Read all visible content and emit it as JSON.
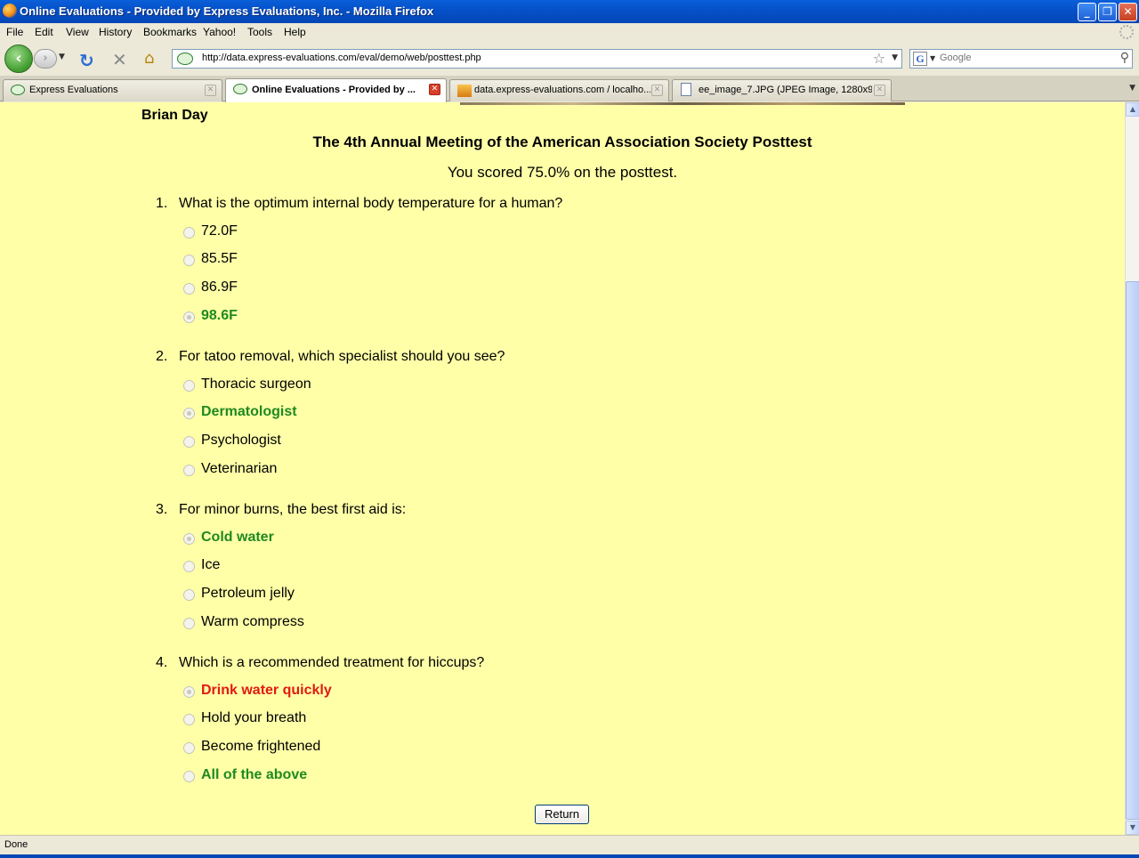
{
  "window": {
    "title": "Online Evaluations - Provided by Express Evaluations, Inc. - Mozilla Firefox",
    "minimize_label": "_",
    "restore_label": "❐",
    "close_label": "✕"
  },
  "menu": [
    "File",
    "Edit",
    "View",
    "History",
    "Bookmarks",
    "Yahoo!",
    "Tools",
    "Help"
  ],
  "nav": {
    "url": "http://data.express-evaluations.com/eval/demo/web/posttest.php",
    "search_placeholder": "Google"
  },
  "tabs": [
    {
      "label": "Express Evaluations",
      "icon": "eye-icon"
    },
    {
      "label": "Online Evaluations - Provided by ...",
      "icon": "eye-icon"
    },
    {
      "label": "data.express-evaluations.com / localho...",
      "icon": "phpmyadmin-icon"
    },
    {
      "label": "ee_image_7.JPG (JPEG Image, 1280x9...",
      "icon": "document-icon"
    }
  ],
  "page": {
    "user_name": "Brian Day",
    "test_title": "The 4th Annual Meeting of the American Association Society Posttest",
    "score_text": "You scored 75.0% on the posttest.",
    "return_label": "Return",
    "colors": {
      "background": "#FFFFA8",
      "correct": "#1F8A1F",
      "incorrect": "#E01B10"
    },
    "questions": [
      {
        "number": "1.",
        "text": "What is the optimum internal body temperature for a human?",
        "options": [
          {
            "label": "72.0F",
            "state": "normal"
          },
          {
            "label": "85.5F",
            "state": "normal"
          },
          {
            "label": "86.9F",
            "state": "normal"
          },
          {
            "label": "98.6F",
            "state": "correct",
            "selected": true
          }
        ]
      },
      {
        "number": "2.",
        "text": "For tatoo removal, which specialist should you see?",
        "options": [
          {
            "label": "Thoracic surgeon",
            "state": "normal"
          },
          {
            "label": "Dermatologist",
            "state": "correct",
            "selected": true
          },
          {
            "label": "Psychologist",
            "state": "normal"
          },
          {
            "label": "Veterinarian",
            "state": "normal"
          }
        ]
      },
      {
        "number": "3.",
        "text": "For minor burns, the best first aid is:",
        "options": [
          {
            "label": "Cold water",
            "state": "correct",
            "selected": true
          },
          {
            "label": "Ice",
            "state": "normal"
          },
          {
            "label": "Petroleum jelly",
            "state": "normal"
          },
          {
            "label": "Warm compress",
            "state": "normal"
          }
        ]
      },
      {
        "number": "4.",
        "text": "Which is a recommended treatment for hiccups?",
        "options": [
          {
            "label": "Drink water quickly",
            "state": "incorrect",
            "selected": true
          },
          {
            "label": "Hold your breath",
            "state": "normal"
          },
          {
            "label": "Become frightened",
            "state": "normal"
          },
          {
            "label": "All of the above",
            "state": "correct",
            "selected": false
          }
        ]
      }
    ]
  },
  "status": {
    "text": "Done"
  }
}
